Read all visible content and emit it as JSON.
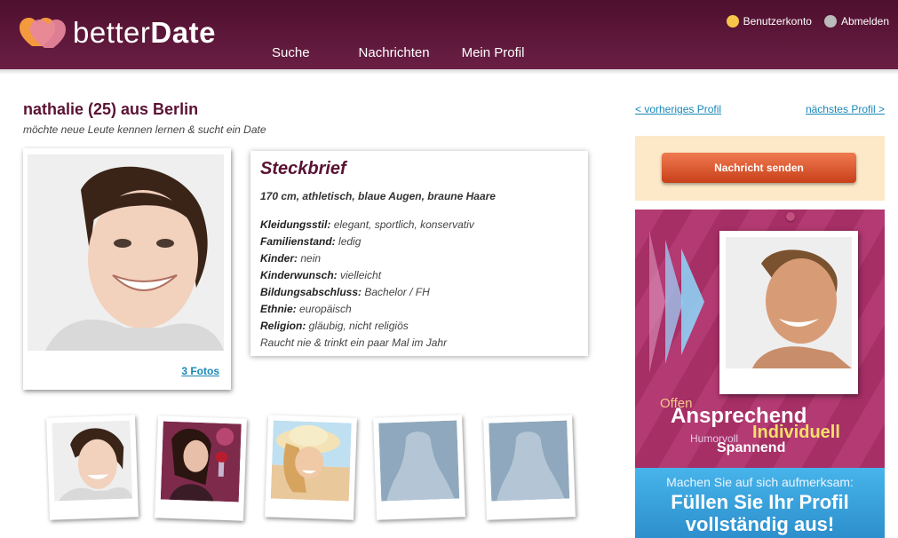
{
  "brand": {
    "name_light": "better",
    "name_bold": "Date",
    "colors": {
      "header": "#5a1233",
      "accent_link": "#1a88b8",
      "button": "#d9552b"
    }
  },
  "nav": {
    "items": [
      {
        "label": "Suche"
      },
      {
        "label": "Nachrichten"
      },
      {
        "label": "Mein Profil"
      }
    ]
  },
  "account": {
    "account_label": "Benutzerkonto",
    "account_icon": "smiley-icon",
    "logout_label": "Abmelden",
    "logout_icon": "power-icon"
  },
  "profile": {
    "title": "nathalie (25) aus Berlin",
    "subtitle": "möchte neue Leute kennen lernen & sucht ein Date",
    "photos_link": "3 Fotos"
  },
  "steckbrief": {
    "title": "Steckbrief",
    "summary": "170 cm, athletisch, blaue Augen, braune Haare",
    "rows": [
      {
        "key": "Kleidungsstil:",
        "value": "elegant, sportlich, konservativ"
      },
      {
        "key": "Familienstand:",
        "value": "ledig"
      },
      {
        "key": "Kinder:",
        "value": "nein"
      },
      {
        "key": "Kinderwunsch:",
        "value": "vielleicht"
      },
      {
        "key": "Bildungsabschluss:",
        "value": "Bachelor / FH"
      },
      {
        "key": "Ethnie:",
        "value": "europäisch"
      },
      {
        "key": "Religion:",
        "value": "gläubig, nicht religiös"
      }
    ],
    "footer": "Raucht nie & trinkt ein paar Mal im Jahr"
  },
  "navigation": {
    "prev": "< vorheriges Profil",
    "next": "nächstes Profil >"
  },
  "message": {
    "button_label": "Nachricht senden"
  },
  "promo": {
    "words": {
      "offen": "Offen",
      "ansprechend": "Ansprechend",
      "individuell": "Individuell",
      "humorvoll": "Humorvoll",
      "spannend": "Spannend"
    },
    "small_text": "Machen Sie auf sich aufmerksam:",
    "big_text_1": "Füllen Sie Ihr Profil",
    "big_text_2": "vollständig aus!"
  }
}
